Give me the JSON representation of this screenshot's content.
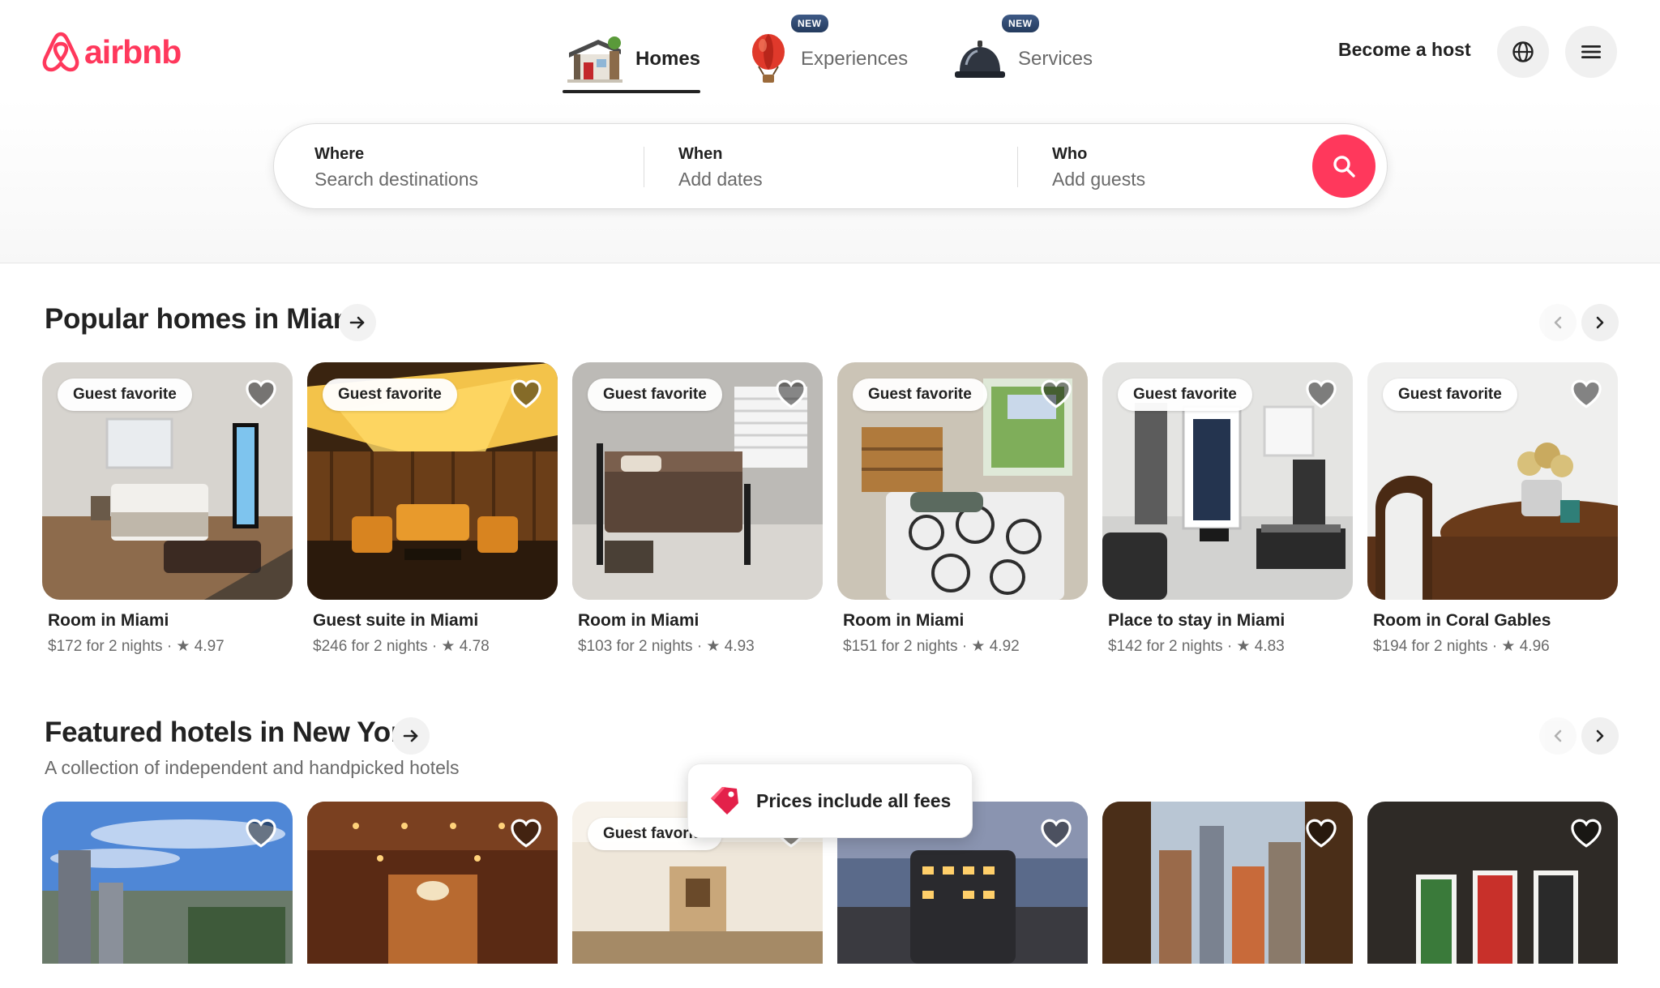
{
  "brand": {
    "name": "airbnb",
    "color": "#ff385c"
  },
  "nav": {
    "tabs": [
      {
        "label": "Homes",
        "icon": "house-icon",
        "active": true
      },
      {
        "label": "Experiences",
        "icon": "hot-air-balloon-icon",
        "badge": "NEW"
      },
      {
        "label": "Services",
        "icon": "service-bell-icon",
        "badge": "NEW"
      }
    ],
    "become_host": "Become a host",
    "language_icon": "globe-icon",
    "menu_icon": "hamburger-menu-icon"
  },
  "search": {
    "where": {
      "label": "Where",
      "placeholder": "Search destinations"
    },
    "when": {
      "label": "When",
      "placeholder": "Add dates"
    },
    "who": {
      "label": "Who",
      "placeholder": "Add guests"
    },
    "button_icon": "search-icon"
  },
  "sections": [
    {
      "title": "Popular homes in Miami",
      "cards": [
        {
          "badge": "Guest favorite",
          "title": "Room in Miami",
          "meta": "$172 for 2 nights · ★ 4.97"
        },
        {
          "badge": "Guest favorite",
          "title": "Guest suite in Miami",
          "meta": "$246 for 2 nights · ★ 4.78"
        },
        {
          "badge": "Guest favorite",
          "title": "Room in Miami",
          "meta": "$103 for 2 nights · ★ 4.93"
        },
        {
          "badge": "Guest favorite",
          "title": "Room in Miami",
          "meta": "$151 for 2 nights · ★ 4.92"
        },
        {
          "badge": "Guest favorite",
          "title": "Place to stay in Miami",
          "meta": "$142 for 2 nights · ★ 4.83"
        },
        {
          "badge": "Guest favorite",
          "title": "Room in Coral Gables",
          "meta": "$194 for 2 nights · ★ 4.96"
        }
      ]
    },
    {
      "title": "Featured hotels in New York",
      "subtitle": "A collection of independent and handpicked hotels",
      "cards": [
        {
          "badge": ""
        },
        {
          "badge": ""
        },
        {
          "badge": "Guest favorite"
        },
        {
          "badge": ""
        },
        {
          "badge": ""
        },
        {
          "badge": ""
        }
      ]
    }
  ],
  "toast": {
    "text": "Prices include all fees",
    "icon": "price-tag-icon"
  }
}
